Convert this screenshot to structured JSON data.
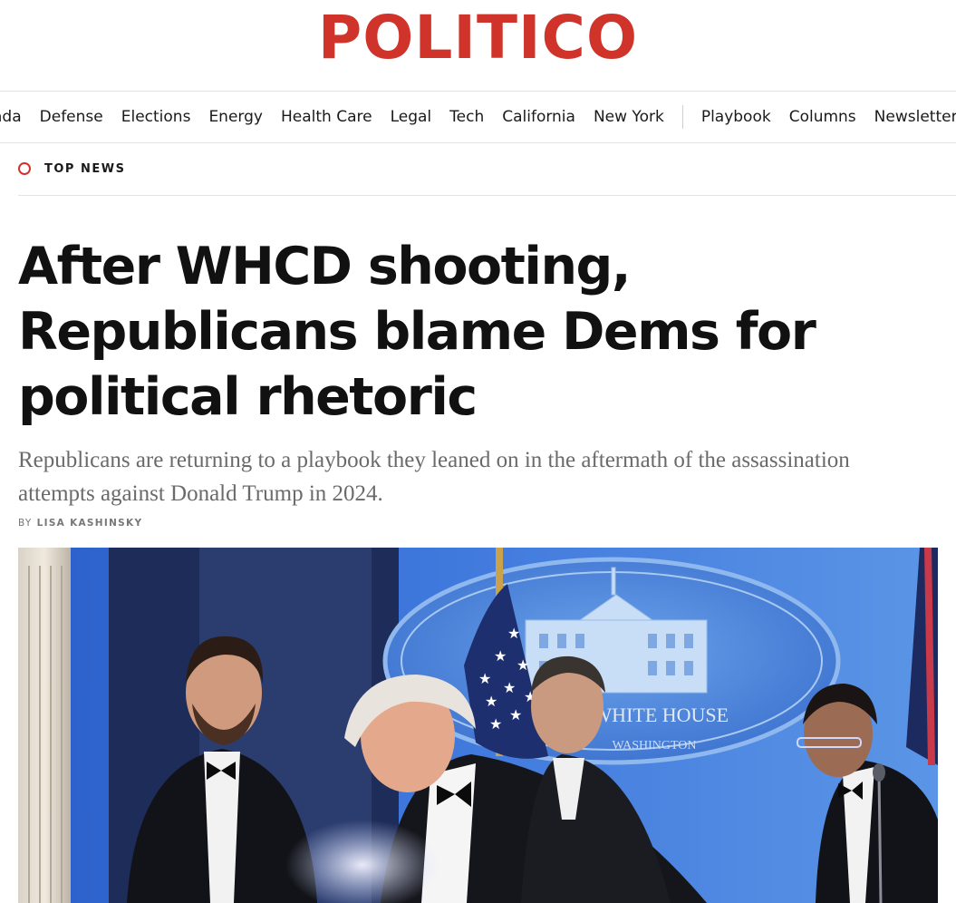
{
  "site": {
    "logo_text": "POLITICO",
    "brand_color": "#d0332a"
  },
  "nav": {
    "items": [
      "ada",
      "Defense",
      "Elections",
      "Energy",
      "Health Care",
      "Legal",
      "Tech",
      "California",
      "New York"
    ],
    "secondary_items": [
      "Playbook",
      "Columns",
      "Newsletters"
    ]
  },
  "section": {
    "label": "TOP NEWS",
    "icon": "circle-ring-icon"
  },
  "article": {
    "headline_lines": [
      "After WHCD shooting,",
      "Republicans blame Dems for",
      "political rhetoric"
    ],
    "dek": "Republicans are returning to a playbook they leaned on in the aftermath of the assassination attempts against Donald Trump in 2024.",
    "byline_prefix": "BY",
    "author": "LISA KASHINSKY"
  },
  "photo": {
    "seal_text_top": "E WHITE HOUSE",
    "seal_text_bottom": "WASHINGTON"
  }
}
